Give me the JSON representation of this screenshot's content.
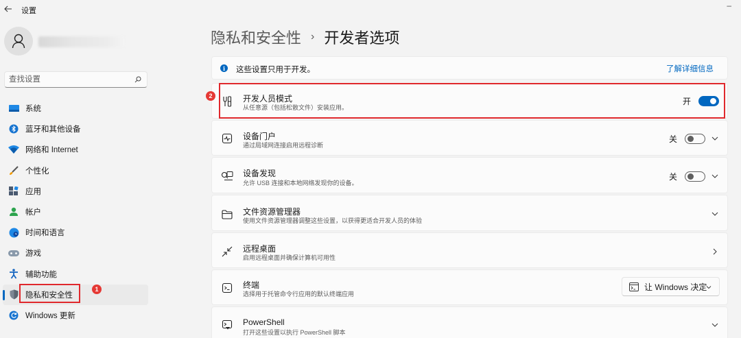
{
  "window": {
    "title": "设置",
    "minimize_glyph": "–"
  },
  "sidebar": {
    "search": {
      "placeholder": "查找设置"
    },
    "items": [
      {
        "label": "系统",
        "icon": "monitor-icon"
      },
      {
        "label": "蓝牙和其他设备",
        "icon": "bluetooth-icon"
      },
      {
        "label": "网络和 Internet",
        "icon": "wifi-icon"
      },
      {
        "label": "个性化",
        "icon": "brush-icon"
      },
      {
        "label": "应用",
        "icon": "apps-icon"
      },
      {
        "label": "帐户",
        "icon": "person-icon"
      },
      {
        "label": "时间和语言",
        "icon": "globe-clock-icon"
      },
      {
        "label": "游戏",
        "icon": "gamepad-icon"
      },
      {
        "label": "辅助功能",
        "icon": "accessibility-icon"
      },
      {
        "label": "隐私和安全性",
        "icon": "shield-icon",
        "active": true
      },
      {
        "label": "Windows 更新",
        "icon": "update-icon"
      }
    ],
    "annotation_badge": "1"
  },
  "breadcrumb": {
    "parent": "隐私和安全性",
    "separator": "›",
    "current": "开发者选项"
  },
  "info_bar": {
    "text": "这些设置只用于开发。",
    "link": "了解详细信息"
  },
  "cards": {
    "developer_mode": {
      "title": "开发人员模式",
      "desc": "从任意源（包括松散文件）安装应用。",
      "state": "开",
      "on": true,
      "badge": "2"
    },
    "device_portal": {
      "title": "设备门户",
      "desc": "通过局域网连接启用远程诊断",
      "state": "关",
      "on": false
    },
    "device_discovery": {
      "title": "设备发现",
      "desc": "允许 USB 连接和本地网络发现你的设备。",
      "state": "关",
      "on": false
    },
    "file_explorer": {
      "title": "文件资源管理器",
      "desc": "使用文件资源管理器调整这些设置，以获得更适合开发人员的体验"
    },
    "remote_desktop": {
      "title": "远程桌面",
      "desc": "启用远程桌面并确保计算机可用性"
    },
    "terminal": {
      "title": "终端",
      "desc": "选择用于托管命令行应用的默认终端应用",
      "select_value": "让 Windows 决定"
    },
    "powershell": {
      "title": "PowerShell",
      "desc": "打开这些设置以执行 PowerShell 脚本"
    }
  },
  "colors": {
    "accent": "#0067c0",
    "highlight": "#e0282c",
    "background": "#f3f3f3",
    "card": "#fbfbfb"
  }
}
